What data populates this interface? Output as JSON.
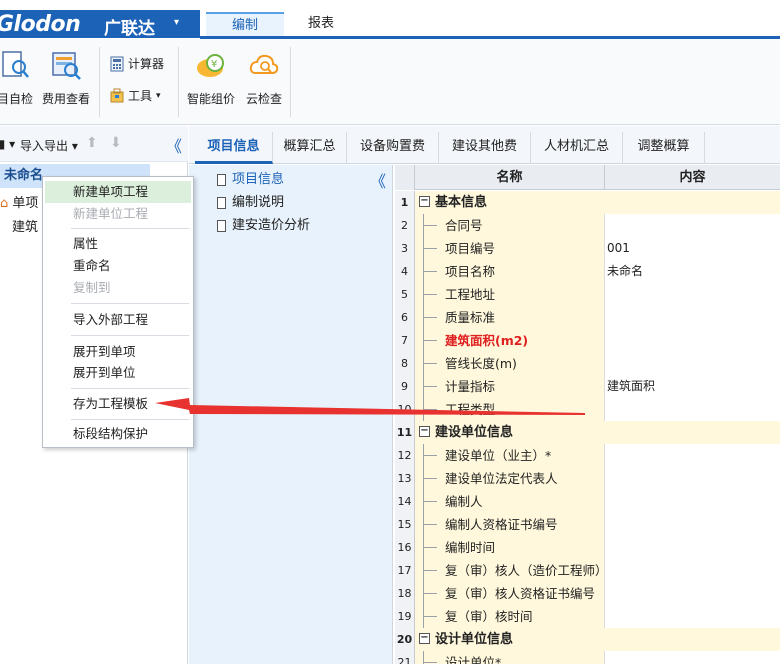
{
  "brand": {
    "logo": "Glodon",
    "logo_cn": "广联达",
    "arrow": "▾"
  },
  "menu": {
    "tab_active": "编制",
    "tab_report": "报表"
  },
  "ribbon": {
    "self_check": "目自检",
    "fee_view": "费用查看",
    "calculator": "计算器",
    "tools": "工具",
    "tools_arrow": "▾",
    "smart_price": "智能组价",
    "cloud_check": "云检查"
  },
  "left_toolbar": {
    "item1": "■ ▾",
    "import_export": "导入导出 ▾",
    "up": "⬆",
    "down": "⬇",
    "collapse": "《"
  },
  "tree": {
    "root": "未命名",
    "item_single": "单项",
    "item_build": "建筑"
  },
  "context_menu": {
    "new_single": "新建单项工程",
    "new_unit": "新建单位工程",
    "properties": "属性",
    "rename": "重命名",
    "copy_to": "复制到",
    "import_external": "导入外部工程",
    "expand_single": "展开到单项",
    "expand_unit": "展开到单位",
    "save_template": "存为工程模板",
    "section_protect": "标段结构保护"
  },
  "tabs": [
    "项目信息",
    "概算汇总",
    "设备购置费",
    "建设其他费",
    "人材机汇总",
    "调整概算"
  ],
  "mid": {
    "items": [
      "项目信息",
      "编制说明",
      "建安造价分析"
    ],
    "collapse": "《"
  },
  "grid": {
    "col_name": "名称",
    "col_content": "内容",
    "rows": [
      {
        "n": "1",
        "name": "基本信息",
        "group": true
      },
      {
        "n": "2",
        "name": "合同号",
        "content": ""
      },
      {
        "n": "3",
        "name": "项目编号",
        "content": "001"
      },
      {
        "n": "4",
        "name": "项目名称",
        "content": "未命名"
      },
      {
        "n": "5",
        "name": "工程地址",
        "content": ""
      },
      {
        "n": "6",
        "name": "质量标准",
        "content": ""
      },
      {
        "n": "7",
        "name": "建筑面积(m2)",
        "content": "",
        "red": true
      },
      {
        "n": "8",
        "name": "管线长度(m)",
        "content": ""
      },
      {
        "n": "9",
        "name": "计量指标",
        "content": "建筑面积"
      },
      {
        "n": "10",
        "name": "工程类型",
        "content": ""
      },
      {
        "n": "11",
        "name": "建设单位信息",
        "group": true
      },
      {
        "n": "12",
        "name": "建设单位（业主）*",
        "content": ""
      },
      {
        "n": "13",
        "name": "建设单位法定代表人",
        "content": ""
      },
      {
        "n": "14",
        "name": "编制人",
        "content": ""
      },
      {
        "n": "15",
        "name": "编制人资格证书编号",
        "content": ""
      },
      {
        "n": "16",
        "name": "编制时间",
        "content": ""
      },
      {
        "n": "17",
        "name": "复（审）核人（造价工程师）",
        "content": ""
      },
      {
        "n": "18",
        "name": "复（审）核人资格证书编号",
        "content": ""
      },
      {
        "n": "19",
        "name": "复（审）核时间",
        "content": ""
      },
      {
        "n": "20",
        "name": "设计单位信息",
        "group": true
      },
      {
        "n": "21",
        "name": "设计单位*",
        "content": ""
      }
    ]
  },
  "colors": {
    "brand_blue": "#1c63b7",
    "highlight_green": "#dcefdc",
    "arrow_red": "#e8322f",
    "name_cell": "#fff8dc"
  }
}
